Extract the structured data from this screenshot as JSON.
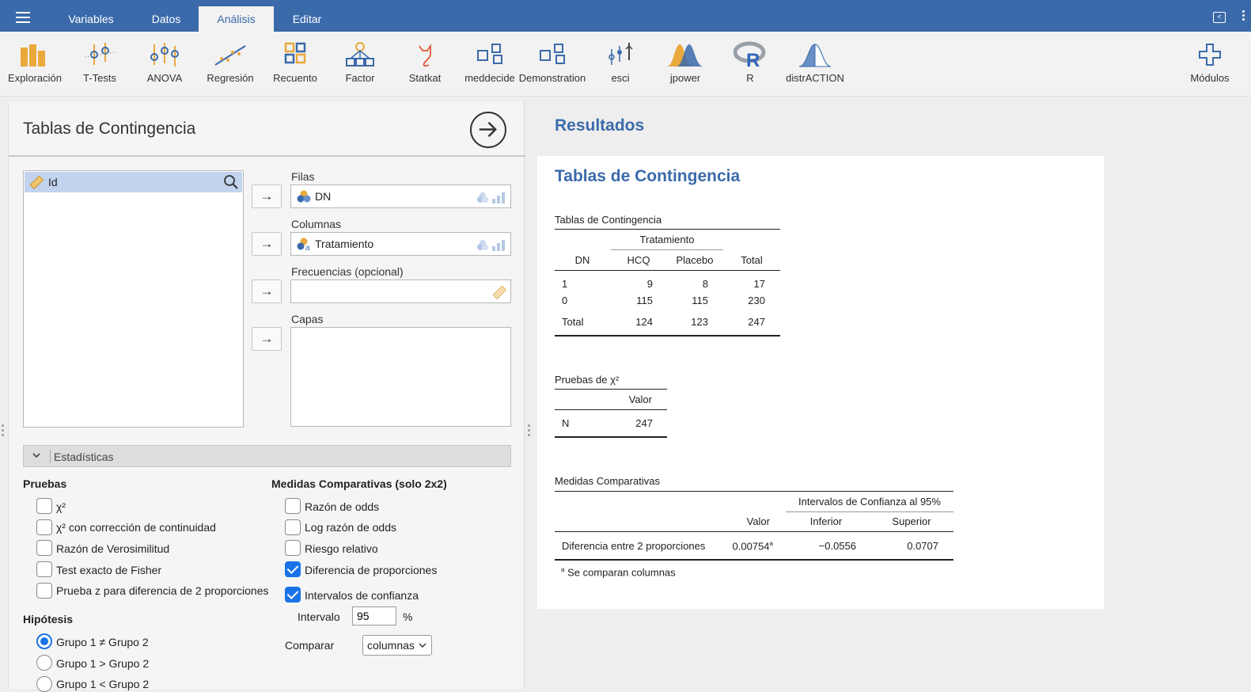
{
  "topbar": {
    "tabs": [
      "Variables",
      "Datos",
      "Análisis",
      "Editar"
    ],
    "active_tab": "Análisis"
  },
  "ribbon": {
    "items": [
      {
        "label": "Exploración",
        "icon": "exploracion-icon"
      },
      {
        "label": "T-Tests",
        "icon": "ttests-icon"
      },
      {
        "label": "ANOVA",
        "icon": "anova-icon"
      },
      {
        "label": "Regresión",
        "icon": "regresion-icon"
      },
      {
        "label": "Recuento",
        "icon": "recuento-icon"
      },
      {
        "label": "Factor",
        "icon": "factor-icon"
      },
      {
        "label": "Statkat",
        "icon": "statkat-icon"
      },
      {
        "label": "meddecide",
        "icon": "meddecide-icon"
      },
      {
        "label": "Demonstration",
        "icon": "demonstration-icon"
      },
      {
        "label": "esci",
        "icon": "esci-icon"
      },
      {
        "label": "jpower",
        "icon": "jpower-icon"
      },
      {
        "label": "R",
        "icon": "r-icon"
      },
      {
        "label": "distrACTION",
        "icon": "distraction-icon"
      }
    ],
    "modules_label": "Módulos"
  },
  "analysis": {
    "title": "Tablas de Contingencia",
    "variables": [
      "Id"
    ],
    "rows_label": "Filas",
    "rows_value": "DN",
    "cols_label": "Columnas",
    "cols_value": "Tratamiento",
    "freq_label": "Frecuencias (opcional)",
    "freq_value": "",
    "layers_label": "Capas",
    "section_label": "Estadísticas",
    "tests_title": "Pruebas",
    "tests": [
      {
        "label": "χ²",
        "checked": false
      },
      {
        "label": "χ² con corrección de continuidad",
        "checked": false
      },
      {
        "label": "Razón de Verosimilitud",
        "checked": false
      },
      {
        "label": "Test exacto de Fisher",
        "checked": false
      },
      {
        "label": "Prueba z para diferencia de 2 proporciones",
        "checked": false
      }
    ],
    "comparative_title": "Medidas Comparativas (solo 2x2)",
    "comparative": [
      {
        "label": "Razón de odds",
        "checked": false
      },
      {
        "label": "Log razón de odds",
        "checked": false
      },
      {
        "label": "Riesgo relativo",
        "checked": false
      },
      {
        "label": "Diferencia de proporciones",
        "checked": true
      },
      {
        "label": "Intervalos de confianza",
        "checked": true
      }
    ],
    "interval_label": "Intervalo",
    "interval_value": "95",
    "percent_sign": "%",
    "compare_label": "Comparar",
    "compare_value": "columnas",
    "hypothesis_title": "Hipótesis",
    "hypothesis": [
      {
        "label": "Grupo 1 ≠ Grupo 2",
        "checked": true
      },
      {
        "label": "Grupo 1 > Grupo 2",
        "checked": false
      },
      {
        "label": "Grupo 1 < Grupo 2",
        "checked": false
      }
    ]
  },
  "results": {
    "header": "Resultados",
    "title": "Tablas de Contingencia",
    "contingency": {
      "caption": "Tablas de Contingencia",
      "span_header": "Tratamiento",
      "columns": [
        "DN",
        "HCQ",
        "Placebo",
        "Total"
      ],
      "rows": [
        [
          "1",
          "9",
          "8",
          "17"
        ],
        [
          "0",
          "115",
          "115",
          "230"
        ],
        [
          "Total",
          "124",
          "123",
          "247"
        ]
      ]
    },
    "chi": {
      "caption": "Pruebas de χ²",
      "value_header": "Valor",
      "row_label": "N",
      "row_value": "247"
    },
    "comparative": {
      "caption": "Medidas Comparativas",
      "ci_header": "Intervalos de Confianza al 95%",
      "col_value": "Valor",
      "col_lower": "Inferior",
      "col_upper": "Superior",
      "row_label": "Diferencia entre 2 proporciones",
      "value": "0.00754",
      "value_sup": "a",
      "lower": "−0.0556",
      "upper": "0.0707",
      "footnote_sup": "a",
      "footnote": "Se comparan columnas"
    }
  },
  "colors": {
    "topbar": "#3b6aab",
    "accent": "#1a73e8",
    "selection": "#c2d3ee"
  }
}
